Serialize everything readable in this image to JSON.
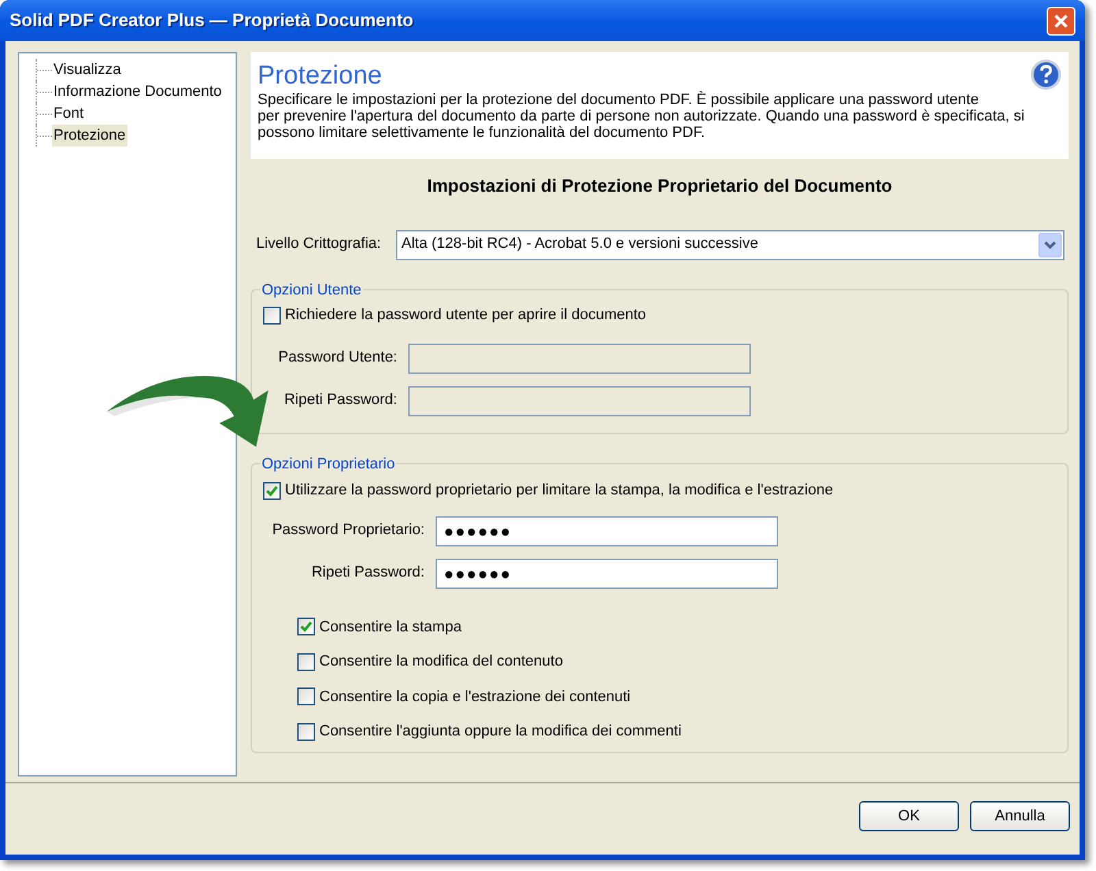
{
  "window": {
    "title": "Solid PDF Creator Plus — Proprietà Documento"
  },
  "sidebar": {
    "items": [
      {
        "label": "Visualizza",
        "selected": false
      },
      {
        "label": "Informazione Documento",
        "selected": false
      },
      {
        "label": "Font",
        "selected": false
      },
      {
        "label": "Protezione",
        "selected": true
      }
    ]
  },
  "header": {
    "title": "Protezione",
    "description": "Specificare le impostazioni per la protezione del documento PDF. È possibile applicare una password utente\nper prevenire l'apertura del documento da parte di persone non autorizzate. Quando una password è specificata, si\npossono limitare selettivamente  le funzionalità del documento PDF."
  },
  "section_heading": "Impostazioni di Protezione Proprietario del Documento",
  "encryption": {
    "label": "Livello Crittografia:",
    "value": "Alta (128-bit RC4) - Acrobat 5.0 e versioni successive"
  },
  "user_options": {
    "legend": "Opzioni Utente",
    "option": {
      "label": "Richiedere la password utente per aprire il documento",
      "checked": false
    },
    "fields": [
      {
        "label": "Password Utente:",
        "disabled": true
      },
      {
        "label": "Ripeti Password:",
        "disabled": true
      }
    ]
  },
  "owner_options": {
    "legend": "Opzioni Proprietario",
    "option": {
      "label": "Utilizzare la password proprietario per limitare la stampa, la modifica e l'estrazione",
      "checked": true
    },
    "fields": [
      {
        "label": "Password Proprietario:",
        "value": "●●●●●●",
        "disabled": false
      },
      {
        "label": "Ripeti Password:",
        "value": "●●●●●●",
        "disabled": false
      }
    ],
    "permissions": [
      {
        "label": "Consentire la stampa",
        "checked": true
      },
      {
        "label": "Consentire la modifica del contenuto",
        "checked": false
      },
      {
        "label": "Consentire la copia e l'estrazione dei contenuti",
        "checked": false
      },
      {
        "label": "Consentire l'aggiunta oppure la modifica dei commenti",
        "checked": false
      }
    ]
  },
  "buttons": [
    {
      "label": "OK"
    },
    {
      "label": "Annulla"
    }
  ]
}
